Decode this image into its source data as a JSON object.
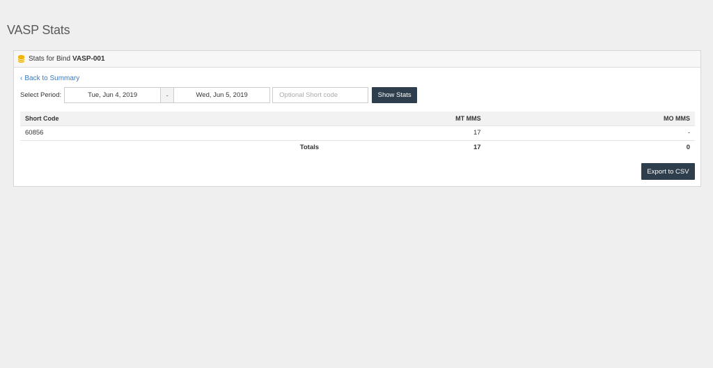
{
  "page": {
    "title": "VASP Stats"
  },
  "panel": {
    "heading_prefix": "Stats for Bind",
    "bind_name": "VASP-001",
    "heading_icon": "database-icon",
    "accent_color": "#f0b400"
  },
  "back_link": {
    "label": "Back to Summary"
  },
  "period": {
    "label": "Select Period:",
    "start_date": "Tue, Jun 4, 2019",
    "separator": "-",
    "end_date": "Wed, Jun 5, 2019",
    "short_code_placeholder": "Optional Short code",
    "short_code_value": "",
    "show_stats_label": "Show Stats"
  },
  "table": {
    "headers": [
      "Short Code",
      "MT MMS",
      "MO MMS"
    ],
    "rows": [
      {
        "short_code": "60856",
        "mt_mms": "17",
        "mo_mms": "-"
      }
    ],
    "totals": {
      "label": "Totals",
      "mt_mms": "17",
      "mo_mms": "0"
    }
  },
  "export": {
    "label": "Export to CSV"
  },
  "colors": {
    "button_bg": "#2e3e4c",
    "link": "#3a7bbf",
    "background": "#efefef"
  }
}
